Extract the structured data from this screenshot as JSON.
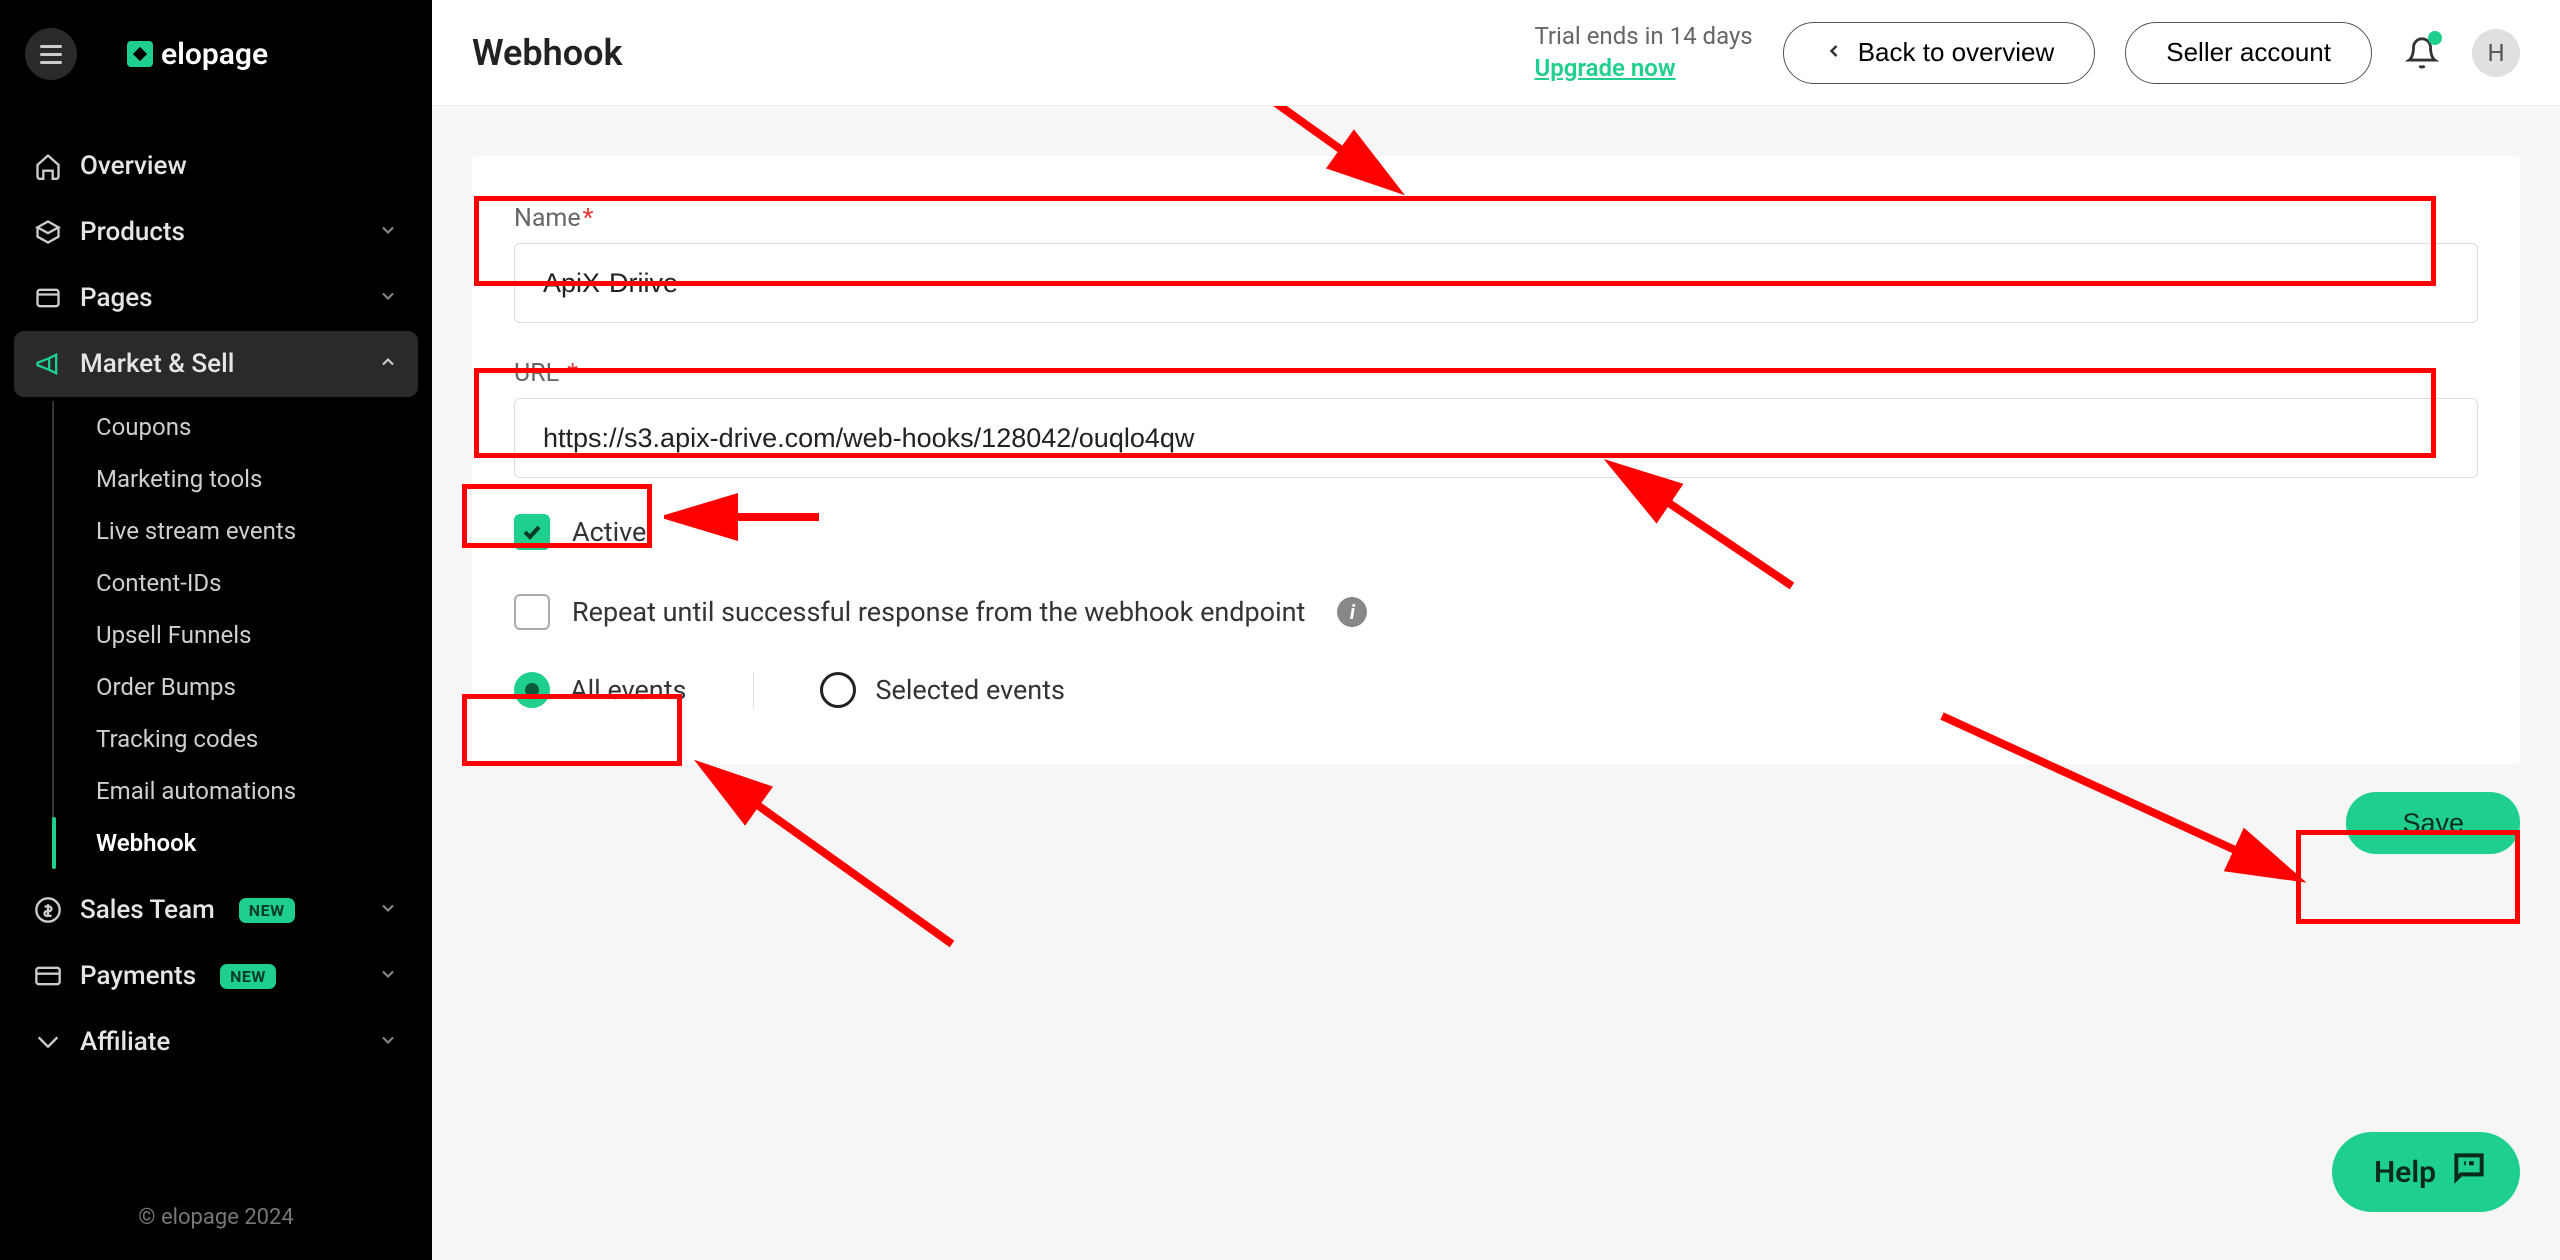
{
  "brand": "elopage",
  "header": {
    "title": "Webhook",
    "trial_line1": "Trial ends in 14 days",
    "trial_cta": "Upgrade now",
    "back_label": "Back to overview",
    "account_label": "Seller account",
    "avatar_initial": "H"
  },
  "sidebar": {
    "items": [
      {
        "label": "Overview"
      },
      {
        "label": "Products"
      },
      {
        "label": "Pages"
      },
      {
        "label": "Market & Sell"
      },
      {
        "label": "Sales Team",
        "badge": "NEW"
      },
      {
        "label": "Payments",
        "badge": "NEW"
      },
      {
        "label": "Affiliate"
      }
    ],
    "submenu": [
      {
        "label": "Coupons"
      },
      {
        "label": "Marketing tools"
      },
      {
        "label": "Live stream events"
      },
      {
        "label": "Content-IDs"
      },
      {
        "label": "Upsell Funnels"
      },
      {
        "label": "Order Bumps"
      },
      {
        "label": "Tracking codes"
      },
      {
        "label": "Email automations"
      },
      {
        "label": "Webhook"
      }
    ],
    "footer": "© elopage 2024"
  },
  "form": {
    "name_label": "Name",
    "name_value": "ApiX-Driive",
    "url_label": "URL",
    "url_value": "https://s3.apix-drive.com/web-hooks/128042/ouqlo4qw",
    "active_label": "Active",
    "active_checked": true,
    "repeat_label": "Repeat until successful response from the webhook endpoint",
    "repeat_checked": false,
    "radio_all": "All events",
    "radio_selected": "Selected events",
    "events_mode": "all",
    "save_label": "Save"
  },
  "help_label": "Help",
  "colors": {
    "accent": "#1fcf8e",
    "annotation": "#ff0000"
  }
}
